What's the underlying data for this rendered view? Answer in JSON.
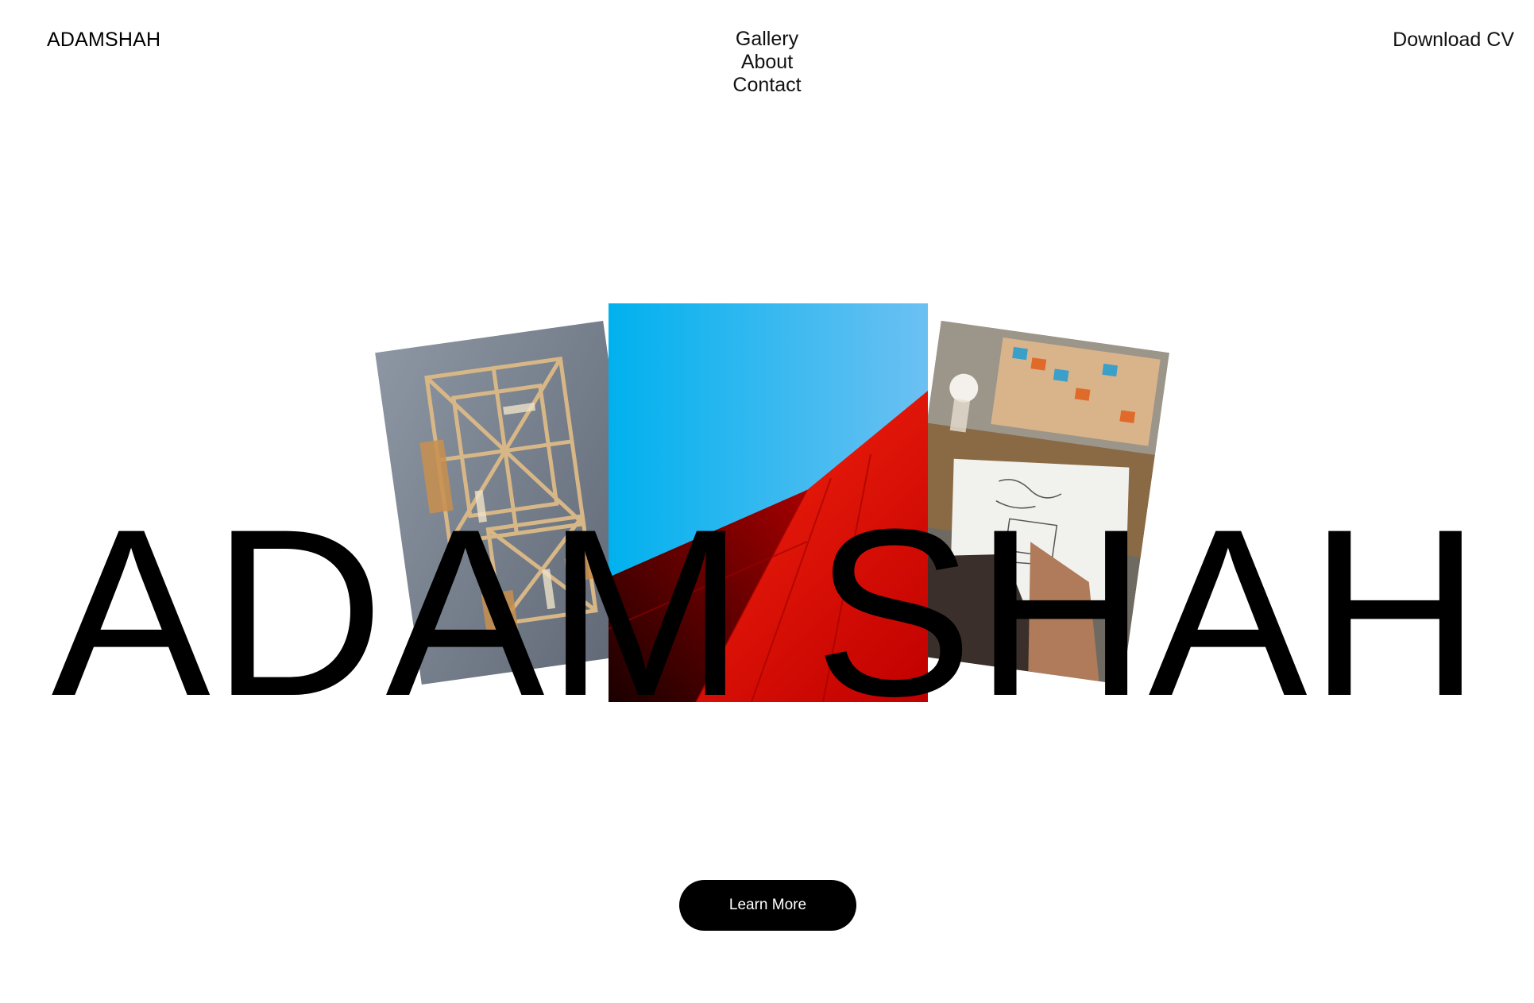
{
  "header": {
    "logo": "ADAMSHAH",
    "nav": [
      "Gallery",
      "About",
      "Contact"
    ],
    "download_label": "Download CV"
  },
  "hero": {
    "title": "ADAM SHAH",
    "images": [
      {
        "name": "construction-aerial-photo"
      },
      {
        "name": "blue-red-architecture-photo"
      },
      {
        "name": "sketching-at-desk-photo"
      }
    ],
    "button_label": "Learn More"
  },
  "colors": {
    "background": "#ffffff",
    "text": "#000000",
    "button_bg": "#000000",
    "button_text": "#ffffff",
    "sky_blue": "#0fb4ef",
    "red": "#e30f08"
  }
}
